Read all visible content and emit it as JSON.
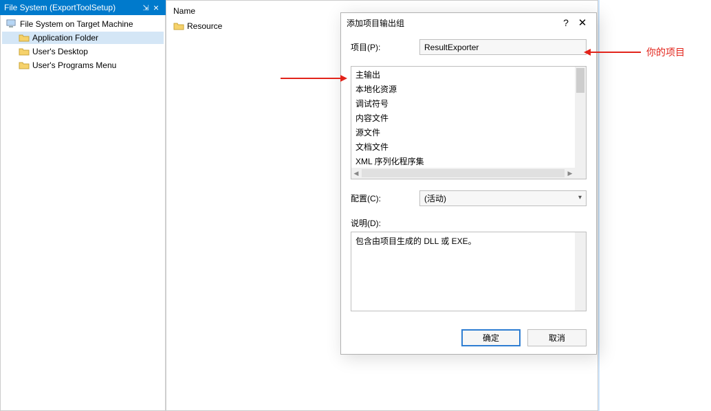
{
  "titlebar": {
    "title": "File System (ExportToolSetup)"
  },
  "tree": {
    "root": "File System on Target Machine",
    "items": [
      {
        "label": "Application Folder",
        "selected": true
      },
      {
        "label": "User's Desktop",
        "selected": false
      },
      {
        "label": "User's Programs Menu",
        "selected": false
      }
    ]
  },
  "listview": {
    "header_name": "Name",
    "rows": [
      {
        "label": "Resource"
      }
    ]
  },
  "dialog": {
    "title": "添加项目输出组",
    "project_label": "项目(P):",
    "project_value": "ResultExporter",
    "output_items": [
      "主输出",
      "本地化资源",
      "调试符号",
      "内容文件",
      "源文件",
      "文档文件",
      "XML 序列化程序集"
    ],
    "config_label": "配置(C):",
    "config_value": "(活动)",
    "desc_label": "说明(D):",
    "desc_text": "包含由项目生成的 DLL 或 EXE。",
    "ok": "确定",
    "cancel": "取消"
  },
  "annotations": {
    "your_project": "你的项目"
  }
}
